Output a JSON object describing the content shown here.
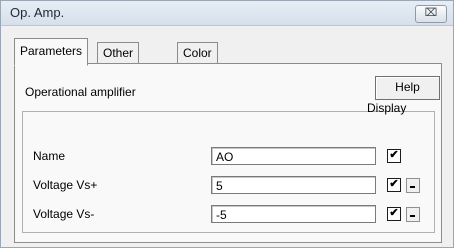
{
  "window": {
    "title": "Op. Amp.",
    "close_label": "⌧"
  },
  "tabs": [
    {
      "label": "Parameters",
      "active": true
    },
    {
      "label": "Other Info",
      "active": false
    },
    {
      "label": "Color",
      "active": false
    }
  ],
  "panel": {
    "heading": "Operational amplifier",
    "help_label": "Help",
    "display_label": "Display",
    "rows": [
      {
        "label": "Name",
        "value": "AO",
        "display_checked": true,
        "has_dropdown": false
      },
      {
        "label": "Voltage Vs+",
        "value": "5",
        "display_checked": true,
        "has_dropdown": true
      },
      {
        "label": "Voltage Vs-",
        "value": "-5",
        "display_checked": true,
        "has_dropdown": true
      }
    ]
  },
  "check_mark": "✔"
}
